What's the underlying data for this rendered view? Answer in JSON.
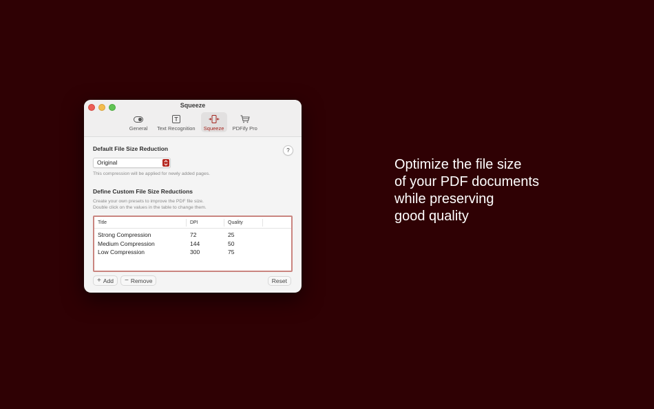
{
  "window": {
    "title": "Squeeze",
    "toolbar": [
      {
        "label": "General",
        "icon": "toggle-icon",
        "active": false
      },
      {
        "label": "Text Recognition",
        "icon": "text-recognition-icon",
        "active": false
      },
      {
        "label": "Squeeze",
        "icon": "squeeze-icon",
        "active": true
      },
      {
        "label": "PDFify Pro",
        "icon": "cart-icon",
        "active": false
      }
    ]
  },
  "default_section": {
    "title": "Default File Size Reduction",
    "help": "?",
    "selected": "Original",
    "hint": "This compression will be applied for newly added pages."
  },
  "custom_section": {
    "title": "Define Custom File Size Reductions",
    "hint_line1": "Create your own presets to improve the PDF file size.",
    "hint_line2": "Double click on the values in the table to change them."
  },
  "table": {
    "headers": {
      "title": "Title",
      "dpi": "DPI",
      "quality": "Quality"
    },
    "rows": [
      {
        "title": "Strong Compression",
        "dpi": "72",
        "quality": "25"
      },
      {
        "title": "Medium Compression",
        "dpi": "144",
        "quality": "50"
      },
      {
        "title": "Low Compression",
        "dpi": "300",
        "quality": "75"
      }
    ]
  },
  "actions": {
    "add": "Add",
    "remove": "Remove",
    "reset": "Reset"
  },
  "tagline": {
    "line1": "Optimize the file size",
    "line2": "of your PDF documents",
    "line3": "while preserving",
    "line4": "good quality"
  },
  "colors": {
    "background": "#2f0104",
    "accent": "#b52a22",
    "table_border": "#c9847f"
  }
}
